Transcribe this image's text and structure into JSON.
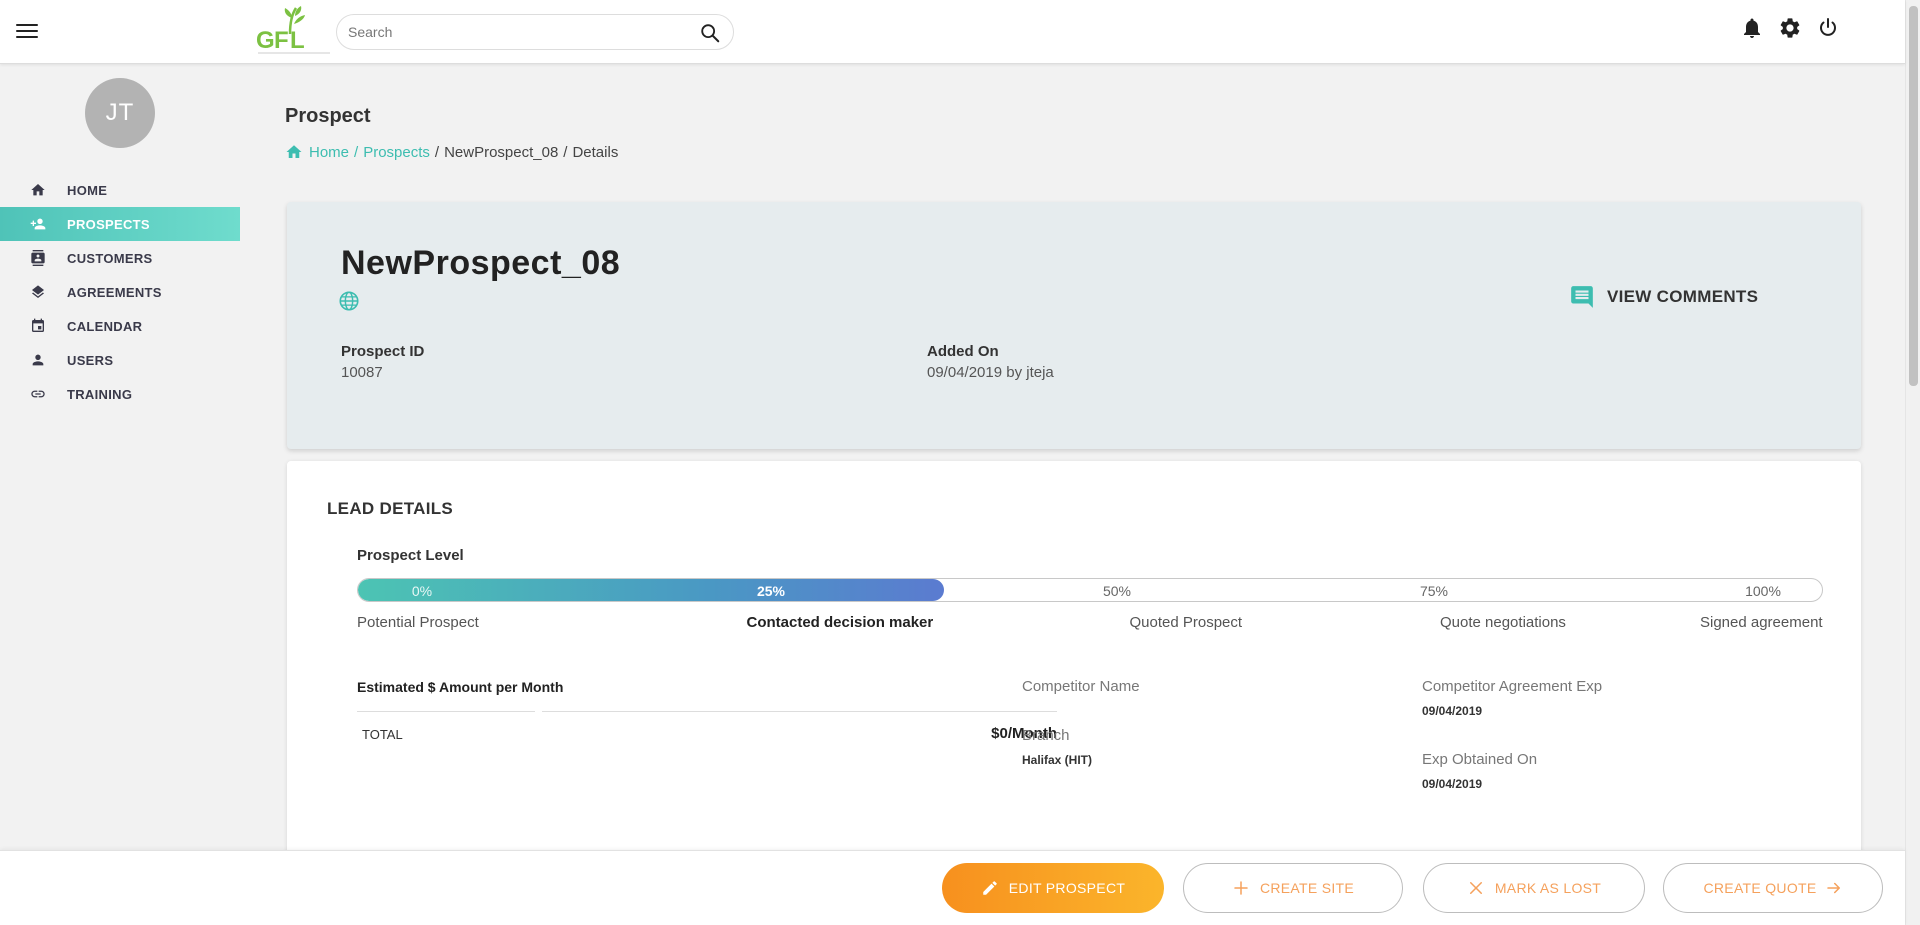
{
  "header": {
    "search_placeholder": "Search",
    "logo_text": "GFL"
  },
  "sidebar": {
    "avatar_initials": "JT",
    "items": [
      {
        "label": "HOME",
        "icon": "home-icon"
      },
      {
        "label": "PROSPECTS",
        "icon": "person-add-icon",
        "active": true
      },
      {
        "label": "CUSTOMERS",
        "icon": "contact-card-icon"
      },
      {
        "label": "AGREEMENTS",
        "icon": "layers-icon"
      },
      {
        "label": "CALENDAR",
        "icon": "calendar-icon"
      },
      {
        "label": "USERS",
        "icon": "user-icon"
      },
      {
        "label": "TRAINING",
        "icon": "link-icon"
      }
    ]
  },
  "page": {
    "title": "Prospect",
    "breadcrumb": {
      "home": "Home",
      "prospects": "Prospects",
      "item": "NewProspect_08",
      "current": "Details",
      "separator": "/"
    }
  },
  "prospect": {
    "name": "NewProspect_08",
    "view_comments": "VIEW COMMENTS",
    "id_label": "Prospect ID",
    "id_value": "10087",
    "added_label": "Added On",
    "added_value": "09/04/2019 by jteja"
  },
  "lead": {
    "title": "LEAD DETAILS",
    "prospect_level_label": "Prospect Level",
    "progress_value": 0.4,
    "percents": [
      "0%",
      "25%",
      "50%",
      "75%",
      "100%"
    ],
    "stages": [
      "Potential Prospect",
      "Contacted decision maker",
      "Quoted Prospect",
      "Quote negotiations",
      "Signed agreement"
    ],
    "current_stage_index": 1,
    "estimate_title": "Estimated $ Amount per Month",
    "total_label": "TOTAL",
    "total_value": "$0/Month",
    "competitor_name_label": "Competitor Name",
    "branch_label": "Branch",
    "branch_value": "Halifax (HIT)",
    "competitor_exp_label": "Competitor Agreement Exp",
    "competitor_exp_value": "09/04/2019",
    "exp_obtained_label": "Exp Obtained On",
    "exp_obtained_value": "09/04/2019"
  },
  "footer": {
    "edit": "EDIT PROSPECT",
    "create_site": "CREATE SITE",
    "mark_lost": "MARK AS LOST",
    "create_quote": "CREATE QUOTE"
  },
  "colors": {
    "accent_teal": "#3dbdb0",
    "accent_orange": "#f7901e",
    "progress_blue": "#5b7bd0"
  }
}
